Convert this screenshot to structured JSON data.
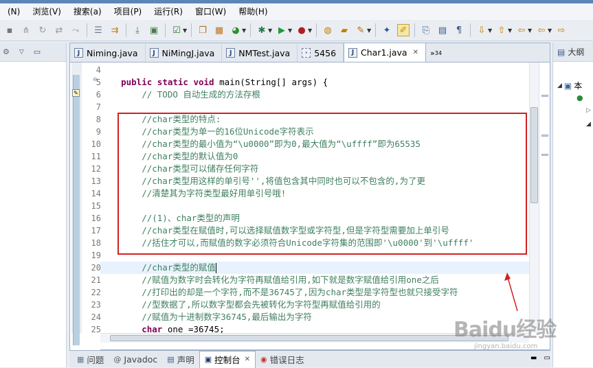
{
  "menu": [
    "(N)",
    "浏览(V)",
    "搜索(a)",
    "项目(P)",
    "运行(R)",
    "窗口(W)",
    "帮助(H)"
  ],
  "toolbar_icons": [
    "new-icon",
    "open-icon",
    "save-icon",
    "print-icon",
    "search-icon",
    "debug-icon",
    "run-icon",
    "breakpoint-icon",
    "build-icon",
    "package-icon",
    "external-tool-icon",
    "coverage-icon",
    "new-class-icon",
    "new-package-icon",
    "open-type-icon",
    "pen-icon",
    "forward-icon",
    "back-icon"
  ],
  "editor": {
    "tabs": [
      {
        "label": "Niming.java",
        "active": false
      },
      {
        "label": "NiMingJ.java",
        "active": false
      },
      {
        "label": "NMTest.java",
        "active": false
      },
      {
        "label": "5456",
        "active": false
      },
      {
        "label": "Char1.java",
        "active": true
      }
    ],
    "overflow_label": "»",
    "overflow_count": "34",
    "line_numbers": [
      "4",
      "5",
      "6",
      "7",
      "8",
      "9",
      "10",
      "11",
      "12",
      "13",
      "14",
      "15",
      "16",
      "17",
      "18",
      "19",
      "20",
      "21",
      "22",
      "23",
      "24",
      "25"
    ],
    "lines": [
      "",
      "    public static void main(String[] args) {",
      "        // TODO 自动生成的方法存根",
      "",
      "        //char类型的特点:",
      "        //char类型为单一的16位Unicode字符表示",
      "        //char类型的最小值为“\\u0000”即为0,最大值为“\\uffff”即为65535",
      "        //char类型的默认值为0",
      "        //char类型可以储存任何字符",
      "        //char类型用这样的单引号'',将值包含其中同时也可以不包含的,为了更",
      "        //清楚其为字符类型最好用单引号哦!",
      "",
      "        //(1)、char类型的声明",
      "        //char类型在赋值时,可以选择赋值数字型或字符型,但是字符型需要加上单引号",
      "        //括住才可以,而赋值的数字必须符合Unicode字符集的范围即'\\u0000'到'\\uffff'",
      "",
      "        //char类型的赋值",
      "        //赋值为数字时会转化为字符再赋值给引用,如下就是数字赋值给引用one之后",
      "        //打印出的却是一个字符,而不是36745了,因为char类型是字符型也就只接受字符",
      "        //型数据了,所以数字型都会先被转化为字符型再赋值给引用的",
      "        //赋值为十进制数字36745,最后输出为字符",
      "        char one =36745;"
    ]
  },
  "right_panel": {
    "header": "大纲",
    "tree_label": "本"
  },
  "bottom_tabs": [
    {
      "label": "问题",
      "icon": "problems-icon",
      "active": false
    },
    {
      "label": "Javadoc",
      "icon": "javadoc-icon",
      "active": false
    },
    {
      "label": "声明",
      "icon": "declaration-icon",
      "active": false
    },
    {
      "label": "控制台",
      "icon": "console-icon",
      "active": true
    },
    {
      "label": "错误日志",
      "icon": "error-log-icon",
      "active": false
    }
  ],
  "watermark": {
    "text": "Baidu经验",
    "url": "jingyan.baidu.com"
  },
  "colors": {
    "highlight_box": "#d02020",
    "comment": "#3f7f5f",
    "keyword": "#7f0055",
    "current_line": "#e8f2fe"
  }
}
